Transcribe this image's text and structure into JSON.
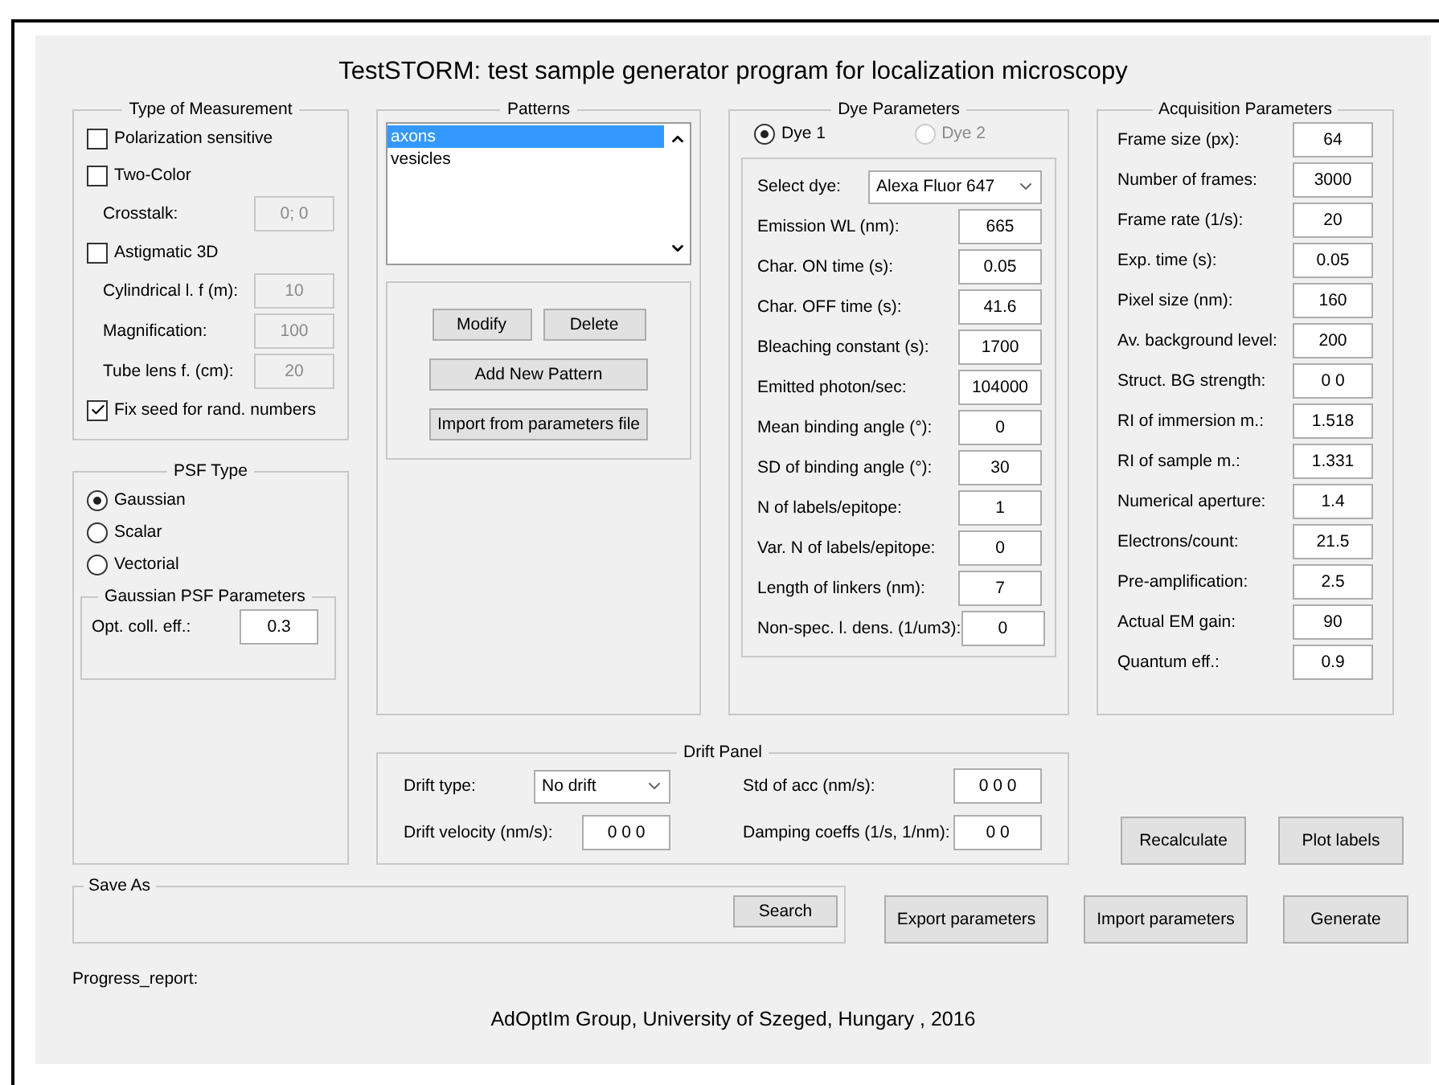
{
  "title": "TestSTORM: test sample generator program for localization microscopy",
  "measurement": {
    "title": "Type of Measurement",
    "items": [
      {
        "kind": "checkbox",
        "label": "Polarization sensitive",
        "checked": false
      },
      {
        "kind": "checkbox",
        "label": "Two-Color",
        "checked": false
      },
      {
        "kind": "field",
        "label": "Crosstalk:",
        "value": "0; 0",
        "disabled": true
      },
      {
        "kind": "checkbox",
        "label": "Astigmatic 3D",
        "checked": false
      },
      {
        "kind": "field",
        "label": "Cylindrical l. f (m):",
        "value": "10",
        "disabled": true
      },
      {
        "kind": "field",
        "label": "Magnification:",
        "value": "100",
        "disabled": true
      },
      {
        "kind": "field",
        "label": "Tube lens f. (cm):",
        "value": "20",
        "disabled": true
      },
      {
        "kind": "checkbox",
        "label": "Fix seed for rand. numbers",
        "checked": true
      }
    ]
  },
  "psf": {
    "title": "PSF Type",
    "options": [
      {
        "label": "Gaussian",
        "selected": true
      },
      {
        "label": "Scalar",
        "selected": false
      },
      {
        "label": "Vectorial",
        "selected": false
      }
    ],
    "sub_title": "Gaussian PSF Parameters",
    "field": {
      "label": "Opt. coll. eff.:",
      "value": "0.3"
    }
  },
  "patterns": {
    "title": "Patterns",
    "items": [
      {
        "label": "axons",
        "selected": true
      },
      {
        "label": "vesicles",
        "selected": false
      }
    ],
    "button_rows": [
      [
        "Modify",
        "Delete"
      ],
      [
        "Add New Pattern"
      ],
      [
        "Import from parameters file"
      ]
    ]
  },
  "dye": {
    "title": "Dye Parameters",
    "radios": [
      {
        "label": "Dye 1",
        "selected": true,
        "disabled": false
      },
      {
        "label": "Dye 2",
        "selected": false,
        "disabled": true
      }
    ],
    "select": {
      "label": "Select dye:",
      "value": "Alexa Fluor 647"
    },
    "fields": [
      {
        "label": "Emission WL (nm):",
        "value": "665"
      },
      {
        "label": "Char. ON time (s):",
        "value": "0.05"
      },
      {
        "label": "Char. OFF time (s):",
        "value": "41.6"
      },
      {
        "label": "Bleaching constant (s):",
        "value": "1700"
      },
      {
        "label": "Emitted photon/sec:",
        "value": "104000"
      },
      {
        "label": "Mean binding angle (°):",
        "value": "0"
      },
      {
        "label": "SD of binding angle (°):",
        "value": "30"
      },
      {
        "label": "N of labels/epitope:",
        "value": "1"
      },
      {
        "label": "Var. N of labels/epitope:",
        "value": "0"
      },
      {
        "label": "Length of linkers (nm):",
        "value": "7"
      },
      {
        "label": "Non-spec. l. dens. (1/um3):",
        "value": "0"
      }
    ]
  },
  "acquisition": {
    "title": "Acquisition Parameters",
    "fields": [
      {
        "label": "Frame size (px):",
        "value": "64"
      },
      {
        "label": "Number of frames:",
        "value": "3000"
      },
      {
        "label": "Frame rate (1/s):",
        "value": "20"
      },
      {
        "label": "Exp. time (s):",
        "value": "0.05"
      },
      {
        "label": "Pixel size (nm):",
        "value": "160"
      },
      {
        "label": "Av. background level:",
        "value": "200"
      },
      {
        "label": "Struct. BG strength:",
        "value": "0 0"
      },
      {
        "label": "RI of immersion m.:",
        "value": "1.518"
      },
      {
        "label": "RI of sample m.:",
        "value": "1.331"
      },
      {
        "label": "Numerical aperture:",
        "value": "1.4"
      },
      {
        "label": "Electrons/count:",
        "value": "21.5"
      },
      {
        "label": "Pre-amplification:",
        "value": "2.5"
      },
      {
        "label": "Actual EM gain:",
        "value": "90"
      },
      {
        "label": "Quantum eff.:",
        "value": "0.9"
      }
    ]
  },
  "drift": {
    "title": "Drift Panel",
    "drift_type": {
      "label": "Drift type:",
      "value": "No drift"
    },
    "velocity": {
      "label": "Drift velocity (nm/s):",
      "value": "0 0 0"
    },
    "std_acc": {
      "label": "Std of acc (nm/s):",
      "value": "0 0 0"
    },
    "damping": {
      "label": "Damping coeffs (1/s, 1/nm):",
      "value": "0 0"
    }
  },
  "side_buttons": [
    "Recalculate",
    "Plot labels"
  ],
  "save_as": {
    "title": "Save As",
    "button": "Search"
  },
  "bottom_buttons": [
    "Export parameters",
    "Import parameters",
    "Generate"
  ],
  "progress_label": "Progress_report:",
  "footer": "AdOptIm Group, University of Szeged, Hungary , 2016"
}
